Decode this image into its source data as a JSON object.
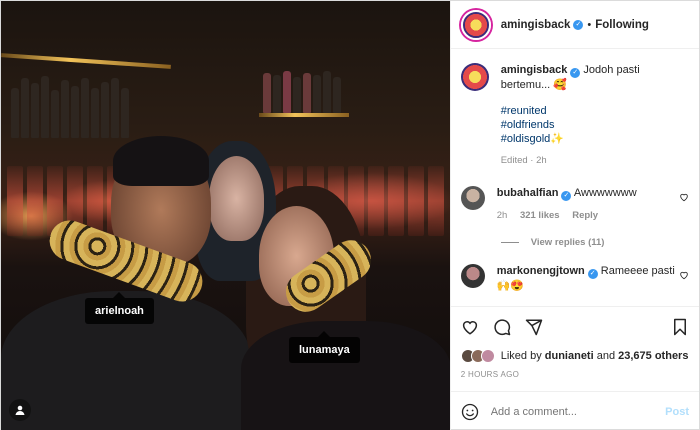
{
  "post": {
    "username": "amingisback",
    "follow_status": "Following",
    "caption_text": "Jodoh pasti bertemu... 🥰",
    "hashtags": [
      "#reunited",
      "#oldfriends",
      "#oldisgold✨"
    ],
    "edited": "Edited · 2h"
  },
  "photo_tags": {
    "left": "arielnoah",
    "right": "lunamaya"
  },
  "comments": [
    {
      "username": "bubahalfian",
      "text": "Awwwwwww",
      "time": "2h",
      "likes": "321 likes",
      "reply": "Reply",
      "view_replies": "View replies (11)"
    },
    {
      "username": "markonengjtown",
      "text": "Rameeee pasti 🙌😍"
    }
  ],
  "likes": {
    "prefix": "Liked by",
    "user": "dunianeti",
    "and": "and",
    "others": "23,675 others"
  },
  "time_ago": "2 HOURS AGO",
  "add_comment": {
    "placeholder": "Add a comment...",
    "post_label": "Post"
  },
  "icons": [
    "heart-icon",
    "comment-icon",
    "share-icon",
    "save-icon",
    "emoji-icon",
    "user-tag-icon",
    "verified-icon"
  ]
}
